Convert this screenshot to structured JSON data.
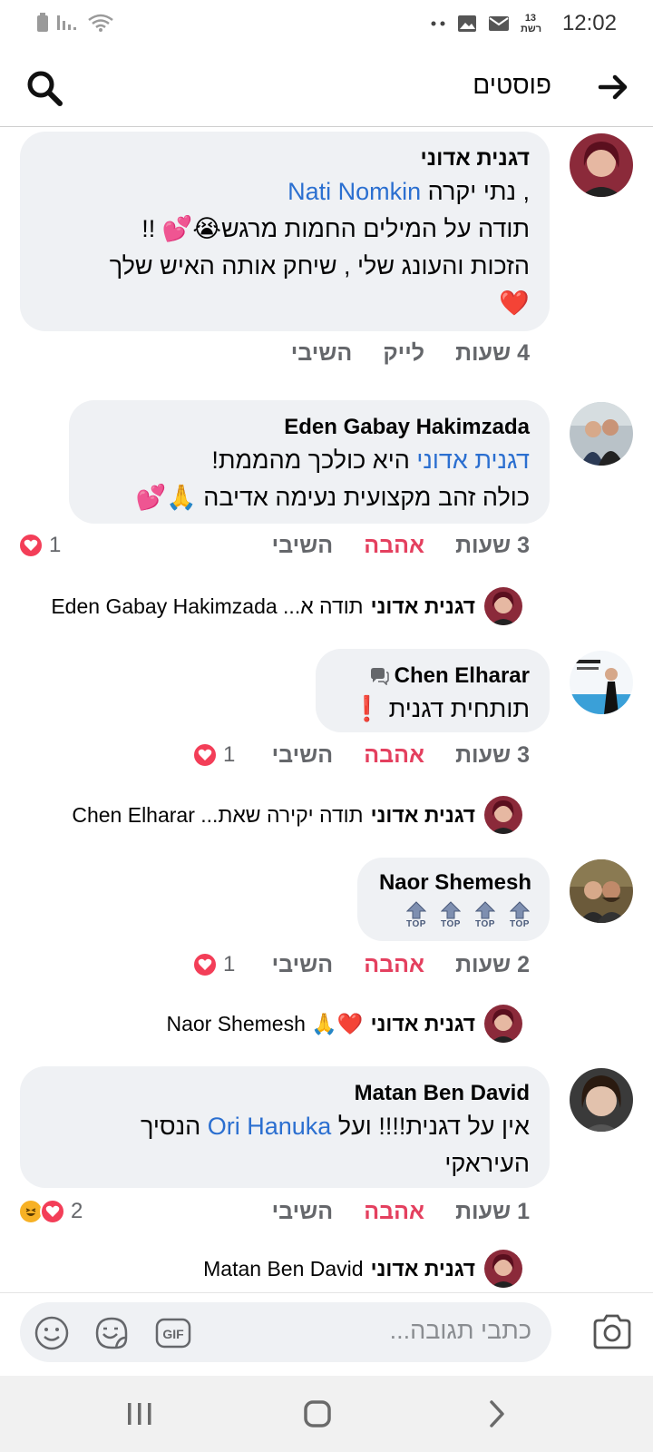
{
  "status_bar": {
    "time": "12:02",
    "channel_icon_text": "13 רשת"
  },
  "header": {
    "title": "פוסטים"
  },
  "comments": [
    {
      "author": "דגנית אדוני",
      "lines": [
        ", נתי יקרה ",
        "תודה על המילים החמות מרגש😭💕 !!",
        "הזכות והעונג שלי , שיחק אותה האיש שלך",
        "❤️"
      ],
      "mention": "Nati Nomkin",
      "time": "4 שעות",
      "like_label": "לייק",
      "reply_label": "השיבי"
    },
    {
      "author": "Eden Gabay Hakimzada",
      "mention": "דגנית אדוני",
      "line1_rest": " היא כולכך מהממת!",
      "line2": "כולה זהב מקצועית נעימה אדיבה 🙏💕",
      "time": "3 שעות",
      "love_label": "אהבה",
      "reply_label": "השיבי",
      "reaction_count": "1",
      "reply_preview": {
        "name": "דגנית אדוני",
        "text": "תודה א... Eden Gabay Hakimzada"
      }
    },
    {
      "author": "Chen Elharar",
      "line1": "תותחית דגנית ❗",
      "time": "3 שעות",
      "love_label": "אהבה",
      "reply_label": "השיבי",
      "reaction_count": "1",
      "reply_preview": {
        "name": "דגנית אדוני",
        "text": "תודה יקירה שאת... Chen Elharar"
      }
    },
    {
      "author": "Naor Shemesh",
      "top_label": "TOP",
      "time": "2 שעות",
      "love_label": "אהבה",
      "reply_label": "השיבי",
      "reaction_count": "1",
      "reply_preview": {
        "name": "דגנית אדוני",
        "text": "❤️🙏 Naor Shemesh"
      }
    },
    {
      "author": "Matan Ben David",
      "line1_start": "אין על דגנית!!!! ועל ",
      "mention": "Ori Hanuka",
      "line1_end": " הנסיך",
      "line2": "העיראקי",
      "time": "1 שעות",
      "love_label": "אהבה",
      "reply_label": "השיבי",
      "reaction_count": "2",
      "reply_preview": {
        "name": "דגנית אדוני",
        "text": "Matan Ben David"
      }
    }
  ],
  "composer": {
    "placeholder": "כתבי תגובה..."
  },
  "colors": {
    "bubble": "#eff1f4",
    "mention": "#2b6fd0",
    "love": "#e4405f",
    "meta": "#65676b"
  }
}
